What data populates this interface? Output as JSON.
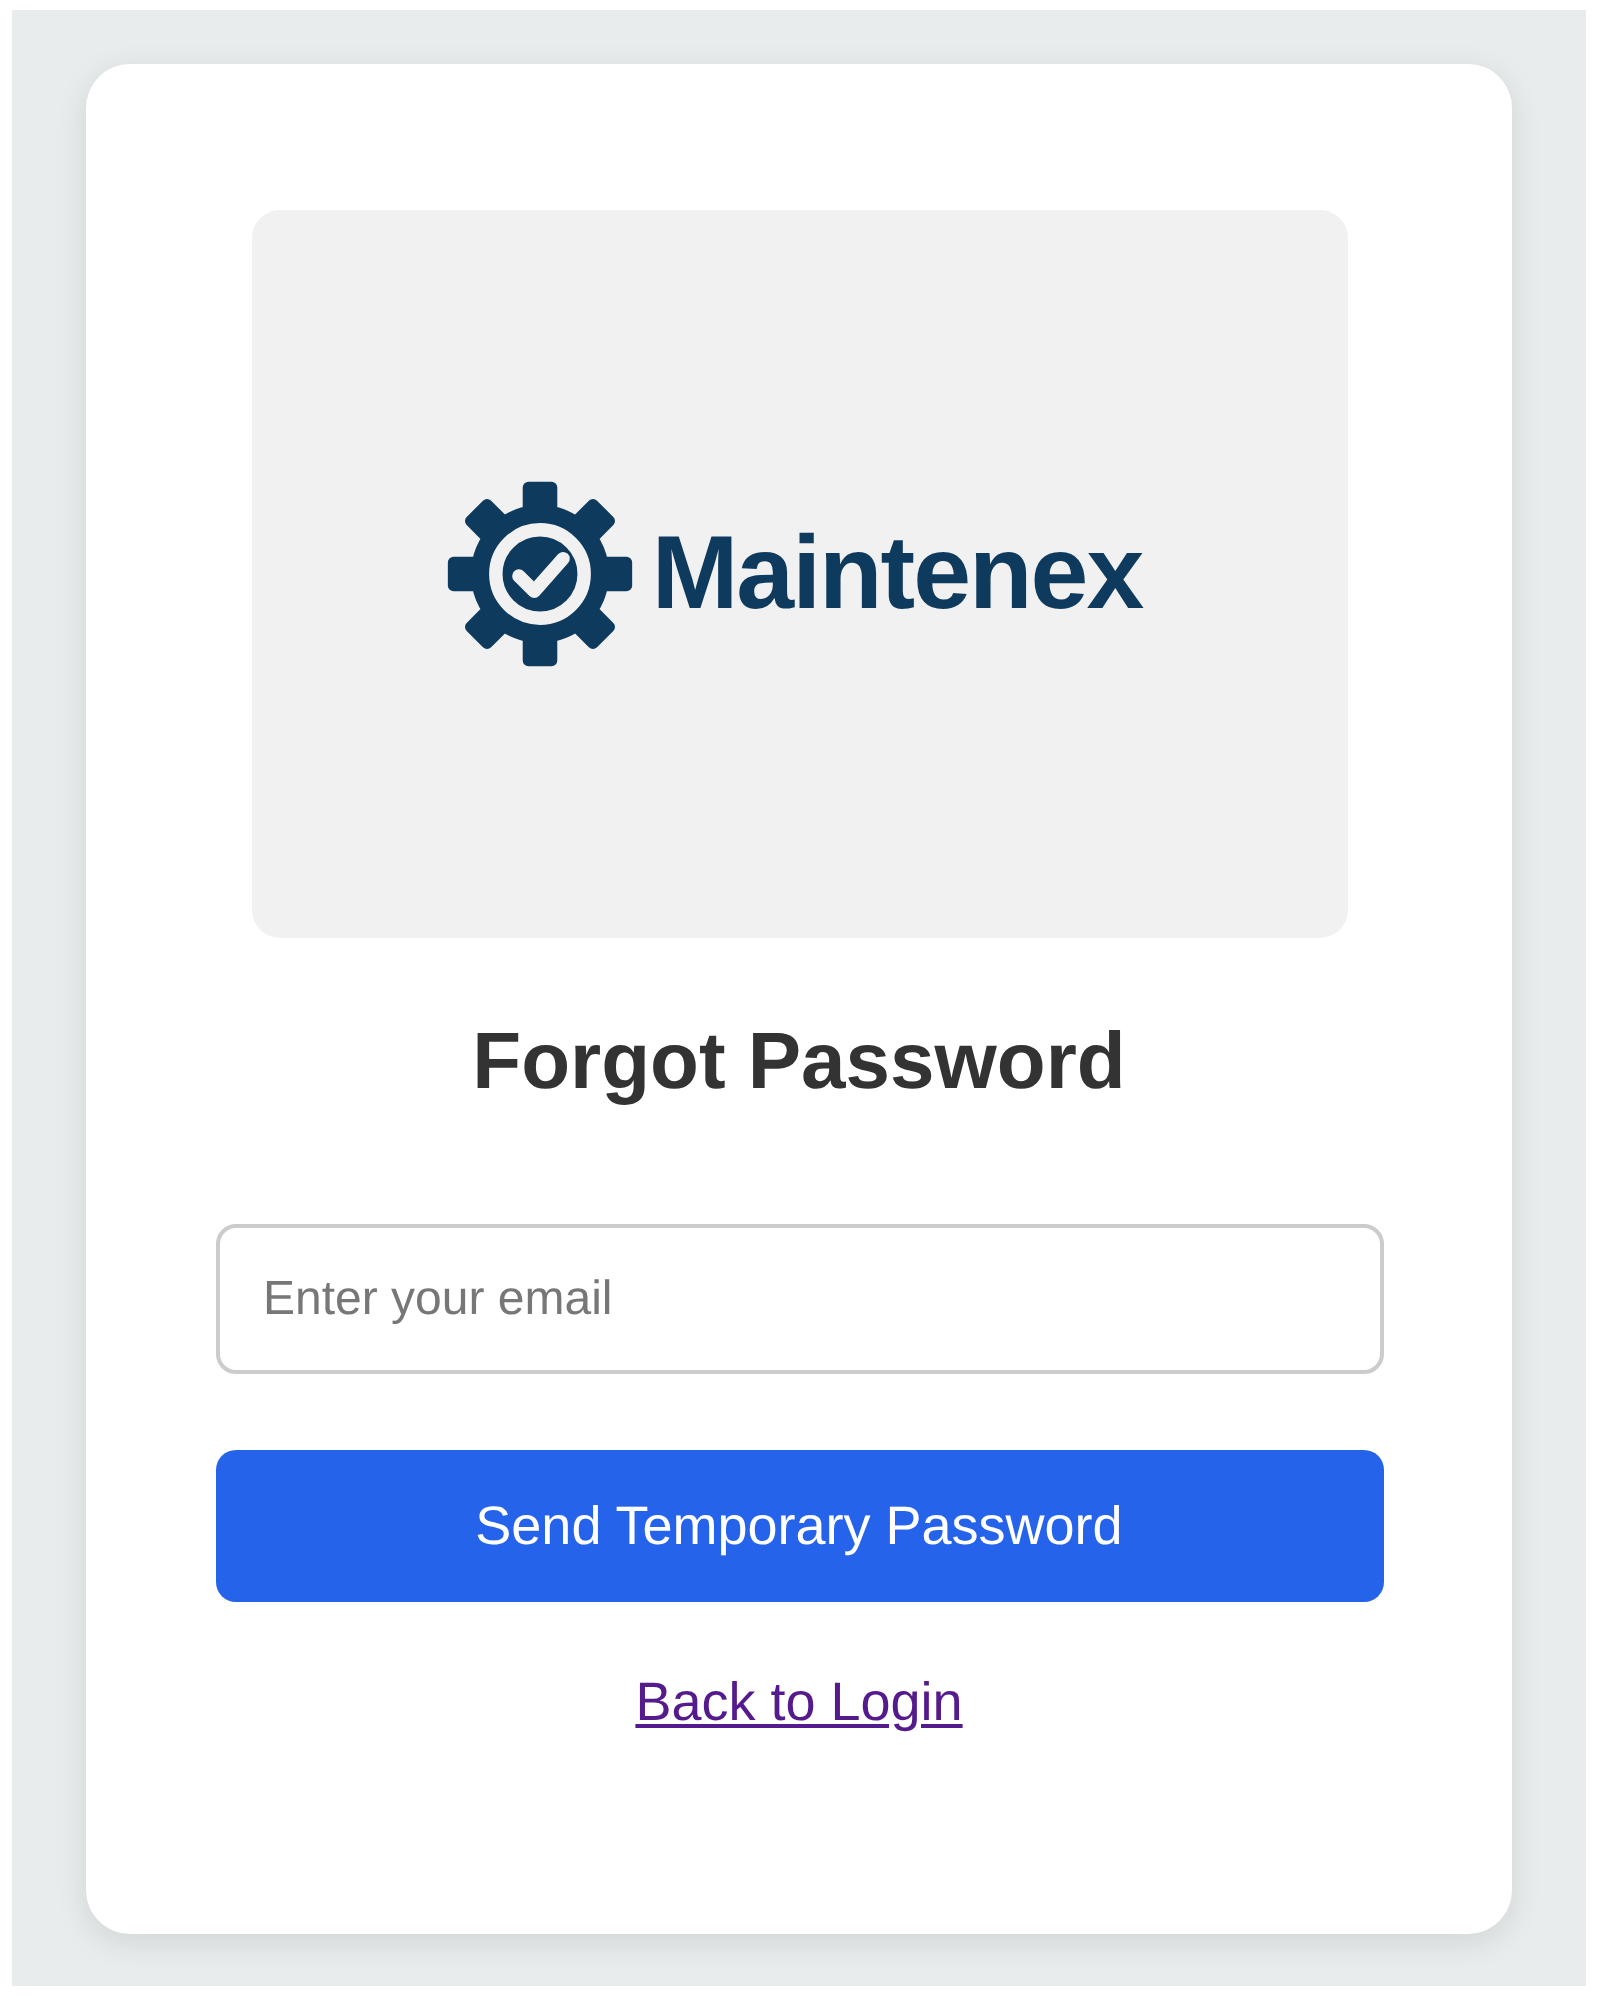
{
  "logo": {
    "text": "Maintenex"
  },
  "title": "Forgot Password",
  "email_field": {
    "placeholder": "Enter your email"
  },
  "submit_button": "Send Temporary Password",
  "back_link": "Back to Login"
}
